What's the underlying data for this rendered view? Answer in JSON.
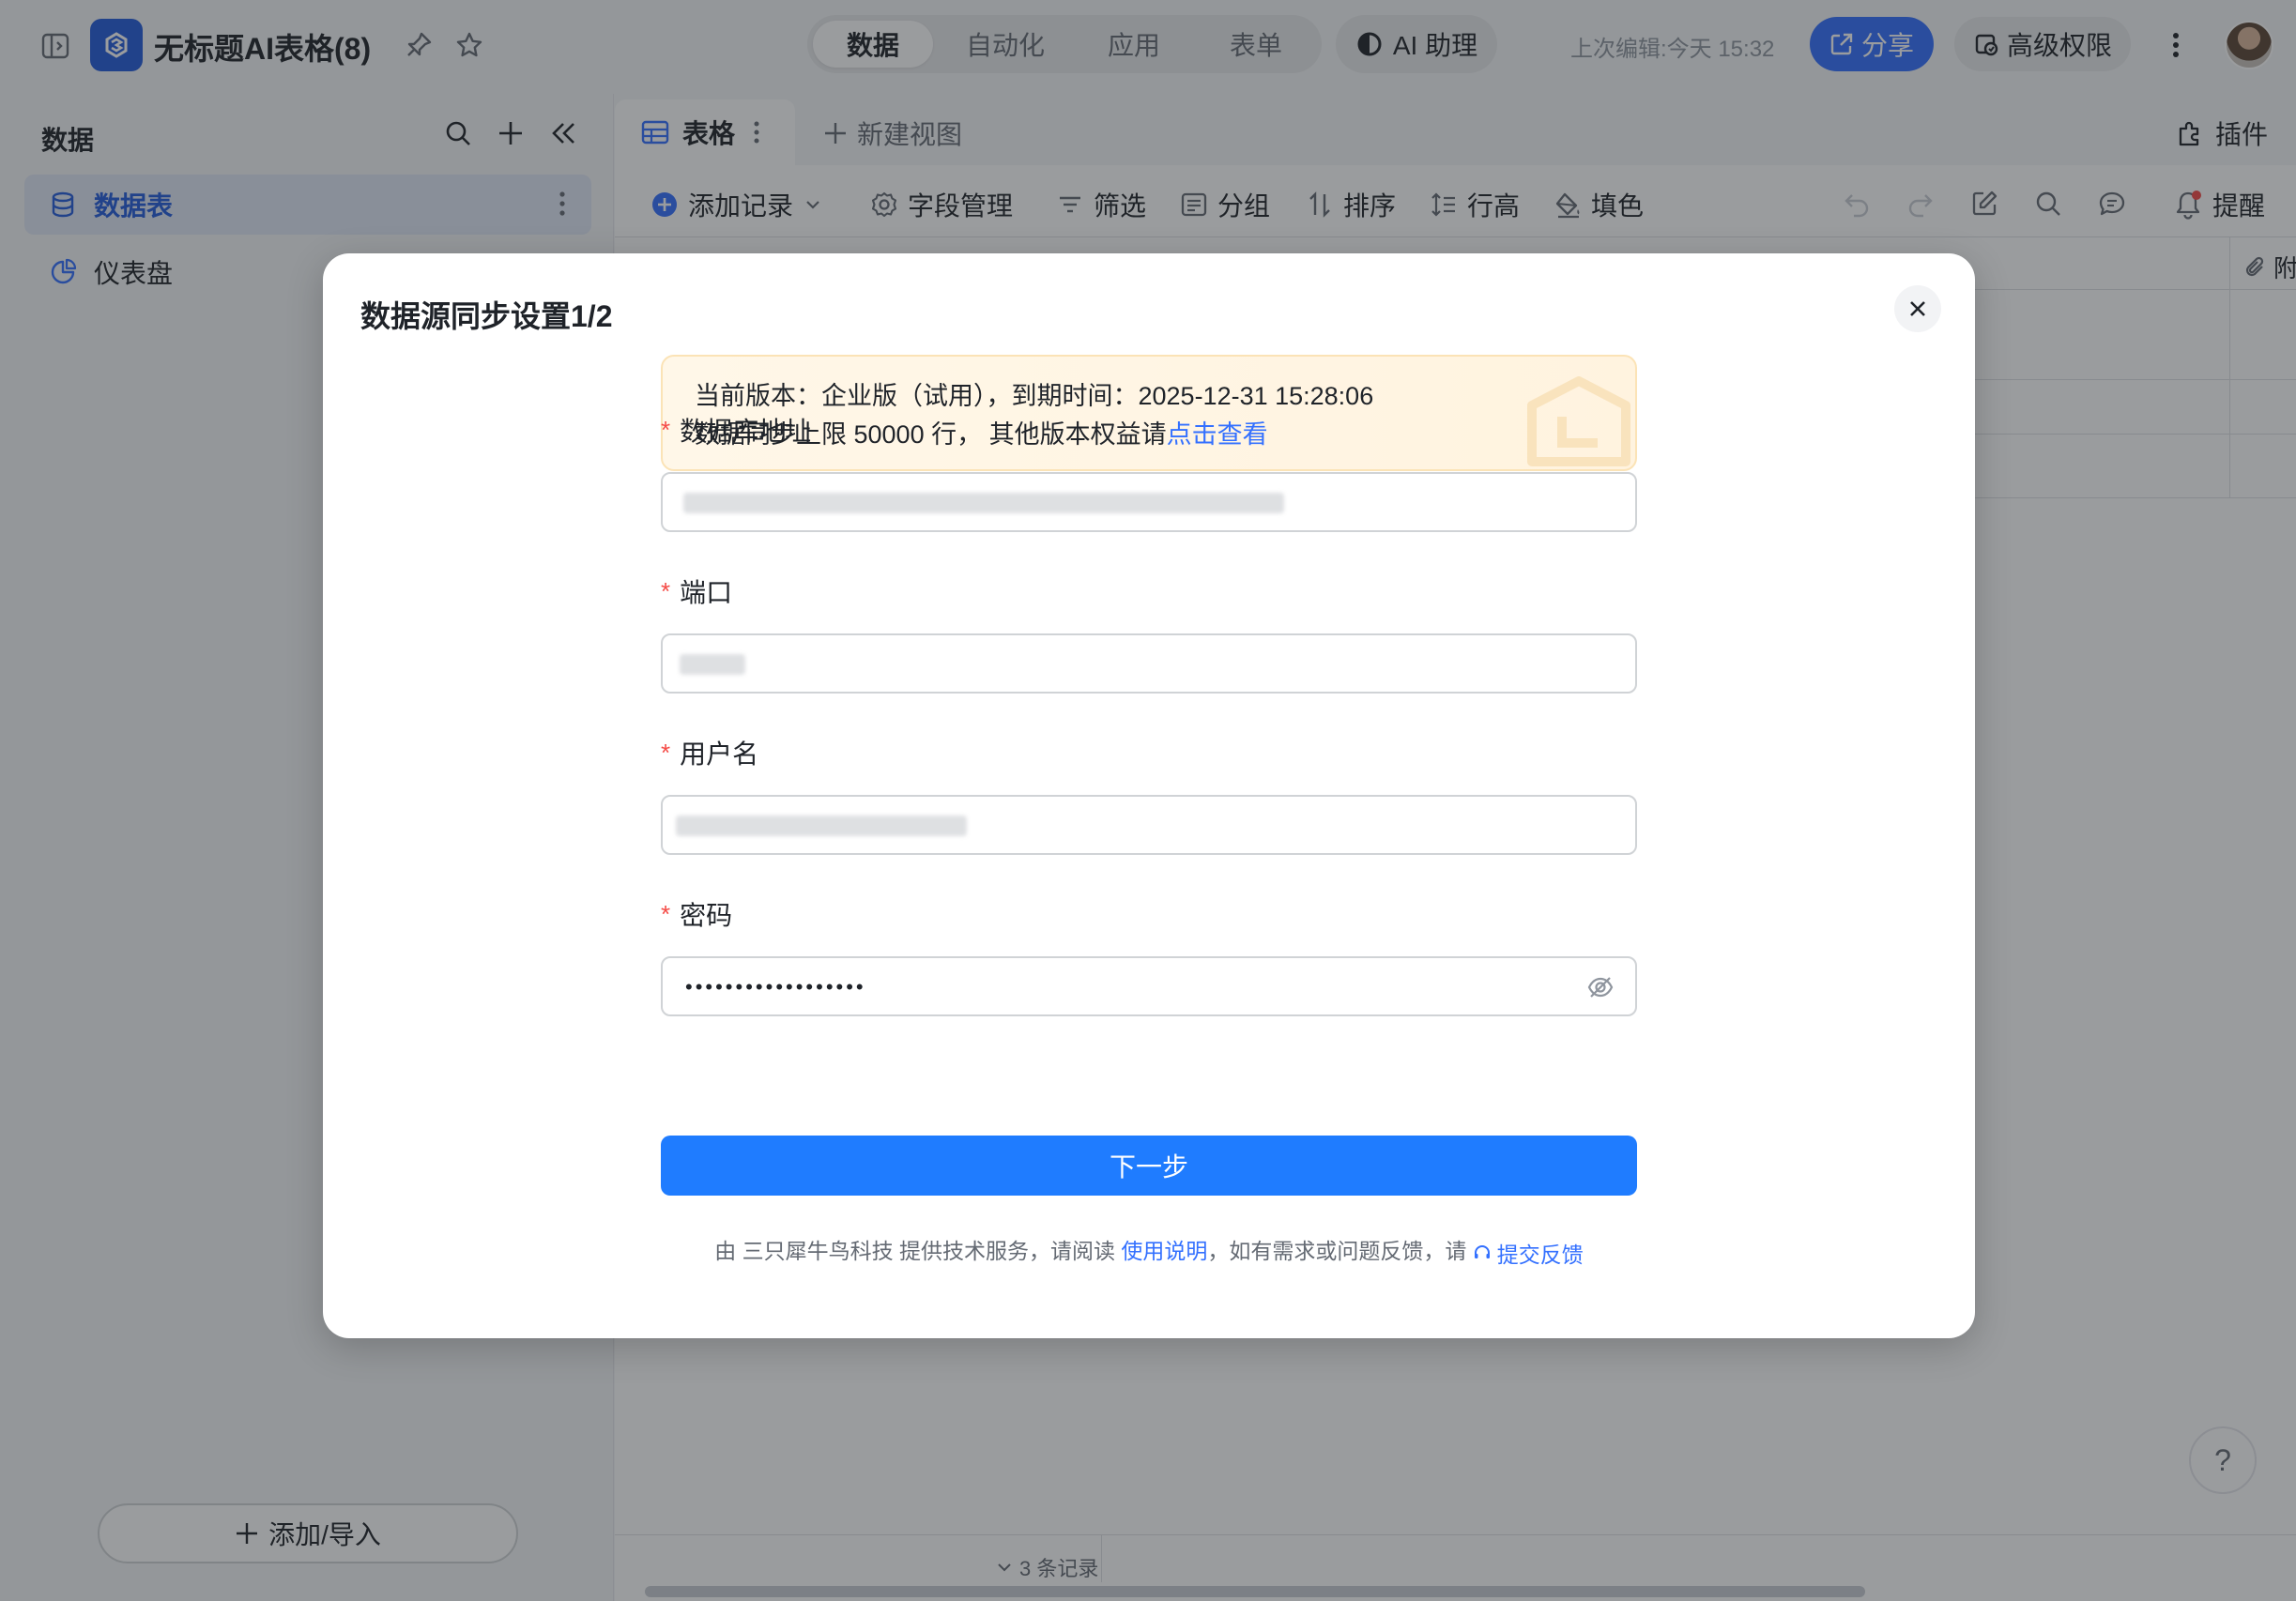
{
  "app": {
    "doc_title": "无标题AI表格(8)",
    "view_modes": [
      "数据",
      "自动化",
      "应用",
      "表单"
    ],
    "active_view_mode": "数据",
    "ai_assistant_label": "AI 助理",
    "last_edited": "上次编辑:今天 15:32",
    "share_label": "分享",
    "advanced_permission_label": "高级权限"
  },
  "sidebar": {
    "title": "数据",
    "items": [
      {
        "label": "数据表",
        "icon": "database-icon",
        "active": true
      },
      {
        "label": "仪表盘",
        "icon": "dashboard-icon",
        "active": false
      }
    ],
    "add_import_label": "添加/导入"
  },
  "main": {
    "active_tab": "表格",
    "new_view_label": "新建视图",
    "plugin_label": "插件",
    "toolbar": {
      "add_record": "添加记录",
      "field_manage": "字段管理",
      "filter": "筛选",
      "group": "分组",
      "sort": "排序",
      "row_height": "行高",
      "fill_color": "填色",
      "reminder": "提醒"
    },
    "column_header_partial": "附",
    "record_count": "3 条记录",
    "help_label": "?"
  },
  "modal": {
    "title": "数据源同步设置1/2",
    "notice_line1": "当前版本：企业版（试用），到期时间：2025-12-31 15:28:06",
    "notice_line2_prefix": "数据同步上限 50000 行，  其他版本权益请",
    "notice_link": "点击查看",
    "fields": {
      "db_address_label": "数据库地址",
      "port_label": "端口",
      "username_label": "用户名",
      "password_label": "密码",
      "password_masked": "••••••••••••••••••"
    },
    "required_mark": "*",
    "next_label": "下一步",
    "footer_prefix": "由 三只犀牛鸟科技 提供技术服务，请阅读 ",
    "footer_link1": "使用说明",
    "footer_middle": "，如有需求或问题反馈，请 ",
    "footer_link2": "提交反馈"
  },
  "colors": {
    "primary": "#3370ff",
    "button_blue": "#1f7cff",
    "required_red": "#f54a45",
    "notice_bg": "#fff7e8"
  }
}
